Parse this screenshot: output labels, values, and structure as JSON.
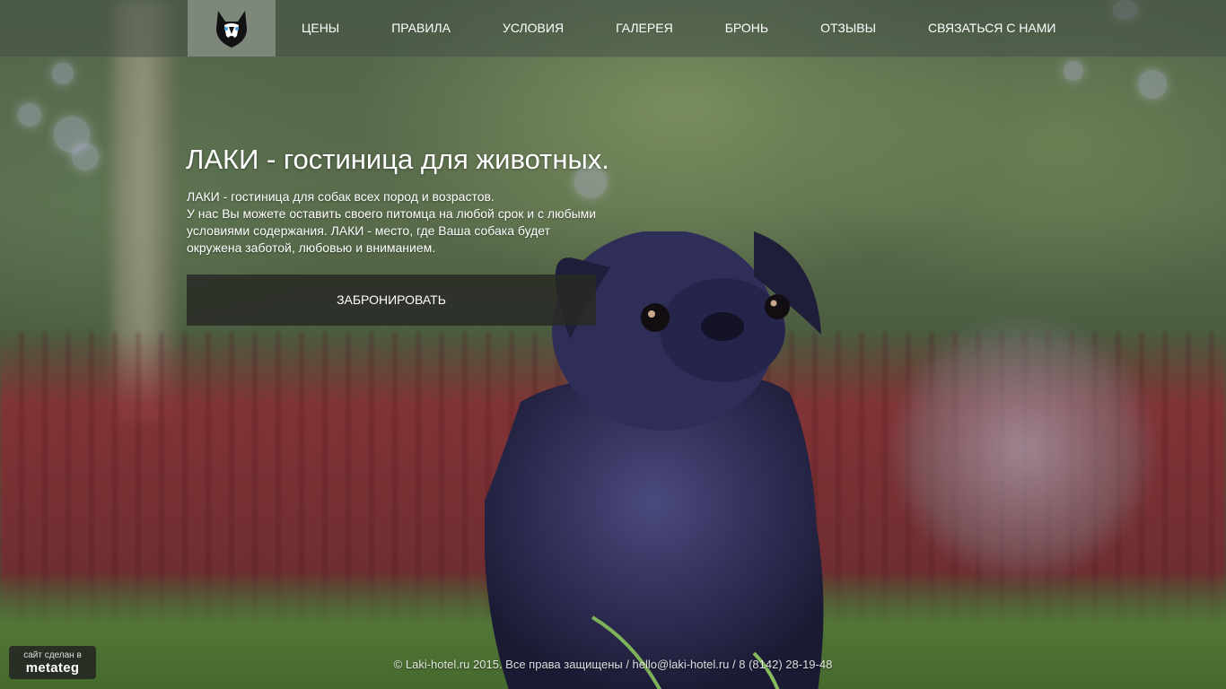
{
  "nav": {
    "logo_icon": "husky-icon",
    "items": [
      "ЦЕНЫ",
      "ПРАВИЛА",
      "УСЛОВИЯ",
      "ГАЛЕРЕЯ",
      "БРОНЬ",
      "ОТЗЫВЫ",
      "СВЯЗАТЬСЯ С НАМИ"
    ]
  },
  "hero": {
    "title": "ЛАКИ - гостиница для животных.",
    "lines": [
      "ЛАКИ - гостиница для собак всех пород и возрастов.",
      "У нас Вы можете оставить своего питомца на любой срок и с любыми условиями содержания. ЛАКИ - место, где Ваша собака будет окружена заботой, любовью и вниманием."
    ],
    "button_label": "ЗАБРОНИРОВАТЬ"
  },
  "footer": {
    "text": "© Laki-hotel.ru 2015. Все права защищены / hello@laki-hotel.ru / 8 (8142) 28-19-48"
  },
  "credit": {
    "line1": "сайт сделан в",
    "line2": "metateg"
  },
  "colors": {
    "navbar_bg": "#465046",
    "button_bg": "#282a26",
    "fence": "#8c2d34"
  }
}
